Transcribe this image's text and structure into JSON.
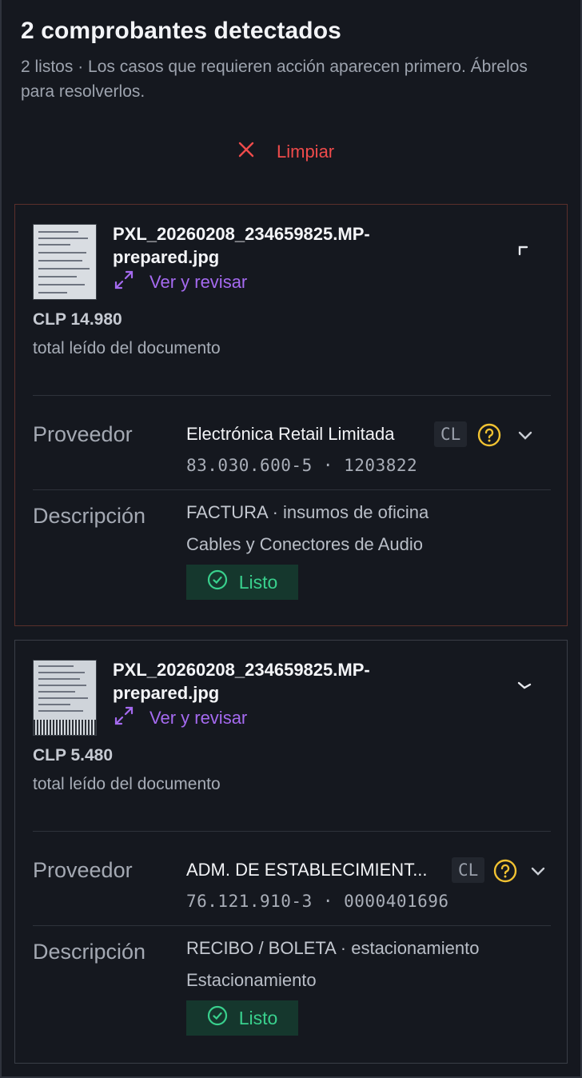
{
  "header": {
    "title": "2 comprobantes detectados",
    "subtitle": "2 listos · Los casos que requieren acción aparecen primero. Ábrelos para resolverlos."
  },
  "actions": {
    "clear_label": "Limpiar"
  },
  "colors": {
    "danger": "#ef4b4b",
    "link": "#a56af0",
    "success": "#39d08d",
    "warning": "#f1c232"
  },
  "documents": [
    {
      "filename": "PXL_20260208_234659825.MP-prepared.jpg",
      "review_label": "Ver y revisar",
      "amount": "CLP 14.980",
      "amount_caption": "total leído del documento",
      "supplier_label": "Proveedor",
      "supplier_name": "Electrónica Retail Limitada",
      "country_tag": "CL",
      "supplier_ids": "83.030.600-5 · 1203822",
      "description_label": "Descripción",
      "doc_type": "FACTURA",
      "category": "· insumos de oficina",
      "detail": "Cables y Conectores de Audio",
      "status": "Listo"
    },
    {
      "filename": "PXL_20260208_234659825.MP-prepared.jpg",
      "review_label": "Ver y revisar",
      "amount": "CLP 5.480",
      "amount_caption": "total leído del documento",
      "supplier_label": "Proveedor",
      "supplier_name": "ADM. DE ESTABLECIMIENT...",
      "country_tag": "CL",
      "supplier_ids": "76.121.910-3 · 0000401696",
      "description_label": "Descripción",
      "doc_type": "RECIBO / BOLETA",
      "category": "· estacionamiento",
      "detail": "Estacionamiento",
      "status": "Listo"
    }
  ]
}
